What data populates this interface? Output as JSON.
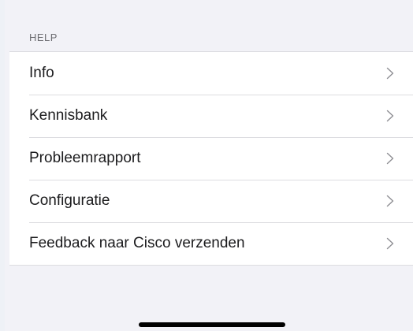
{
  "section": {
    "header": "HELP"
  },
  "rows": [
    {
      "label": "Info",
      "icon": "chevron-right-icon"
    },
    {
      "label": "Kennisbank",
      "icon": "chevron-right-icon"
    },
    {
      "label": "Probleemrapport",
      "icon": "chevron-right-icon"
    },
    {
      "label": "Configuratie",
      "icon": "chevron-right-icon"
    },
    {
      "label": "Feedback naar Cisco verzenden",
      "icon": "chevron-right-icon"
    }
  ],
  "colors": {
    "background": "#f2f2f7",
    "cell": "#ffffff",
    "separator": "#dcdce0",
    "text": "#1c1c1e",
    "header_text": "#6d6d72",
    "chevron": "#8e8e93"
  }
}
